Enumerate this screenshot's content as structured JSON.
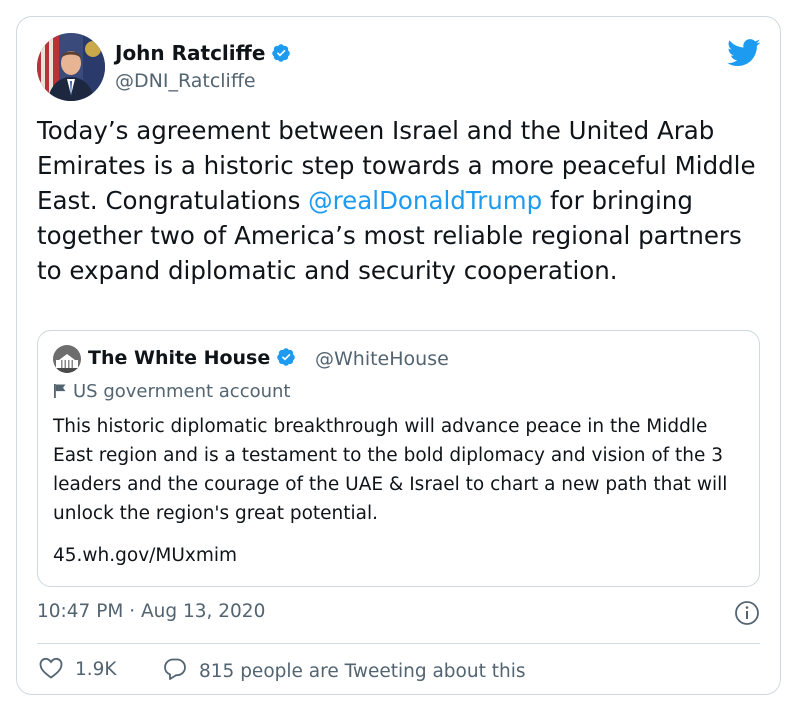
{
  "tweet": {
    "author": {
      "name": "John Ratcliffe",
      "handle": "@DNI_Ratcliffe",
      "verified": true
    },
    "text": {
      "before": "Today’s agreement between Israel and the United Arab Emirates is a historic step towards a more peaceful Middle East. Congratulations ",
      "mention": "@realDonaldTrump",
      "after": " for bringing together two of America’s most reliable regional partners to expand diplomatic and security cooperation."
    },
    "timestamp": "10:47 PM · Aug 13, 2020",
    "likes": "1.9K",
    "talking_about": "815 people are Tweeting about this"
  },
  "quoted_tweet": {
    "name": "The White House",
    "handle": "@WhiteHouse",
    "verified": true,
    "label": "US government account",
    "text": "This historic diplomatic breakthrough will advance peace in the Middle East region and is a testament to the bold diplomacy and vision of the 3 leaders and the courage of the UAE & Israel to chart a new path that will unlock the region's great potential.",
    "link": "45.wh.gov/MUxmim"
  },
  "icons": {
    "logo": "twitter-bird-icon",
    "verified": "verified-badge-icon",
    "government": "flag-icon",
    "info": "info-icon",
    "like": "heart-icon",
    "reply": "speech-bubble-icon"
  },
  "colors": {
    "accent": "#1d9bf0",
    "text": "#0f1419",
    "secondary": "#536471",
    "border": "#cfd9de"
  }
}
